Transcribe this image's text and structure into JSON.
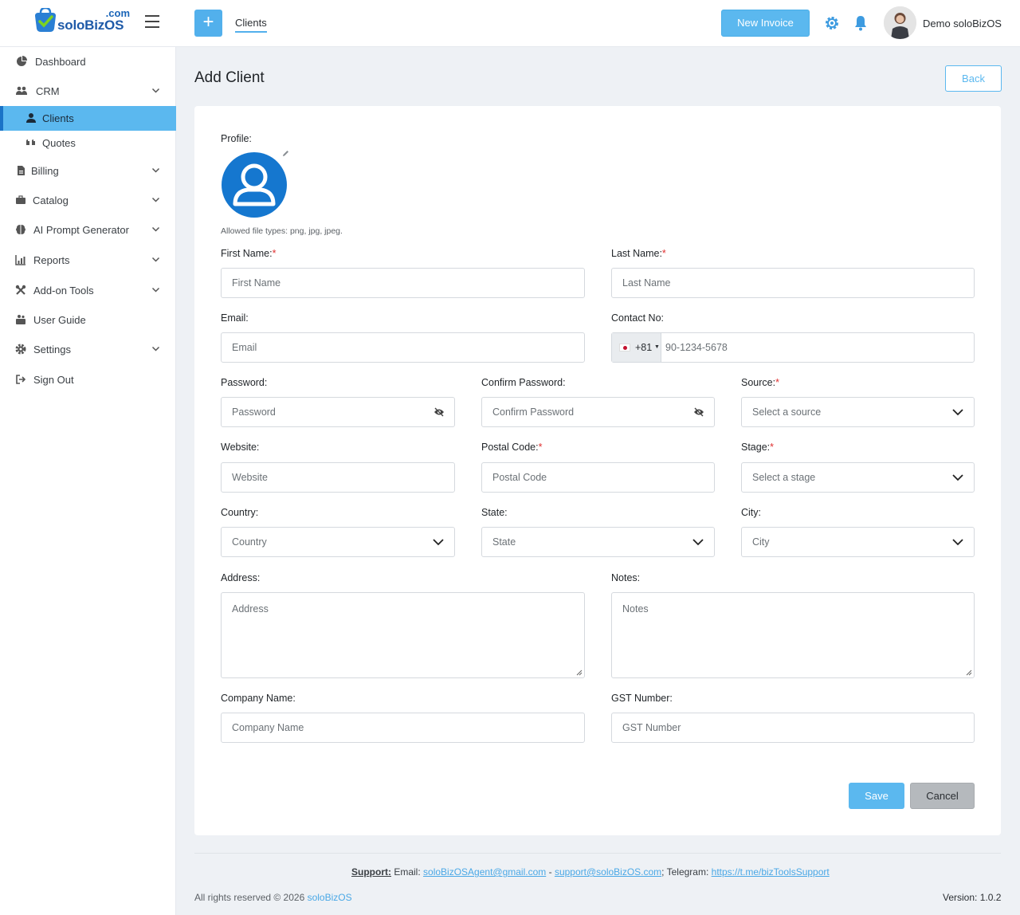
{
  "header": {
    "logo_suffix": ".com",
    "logo_text": "soloBizOS",
    "tab_label": "Clients",
    "new_invoice_label": "New Invoice",
    "user_name": "Demo soloBizOS"
  },
  "sidebar": {
    "items": [
      {
        "label": "Dashboard",
        "icon": "dashboard-icon"
      },
      {
        "label": "CRM",
        "icon": "users-icon",
        "expandable": true
      },
      {
        "label": "Clients",
        "icon": "user-icon",
        "active": true
      },
      {
        "label": "Quotes",
        "icon": "quote-icon"
      },
      {
        "label": "Billing",
        "icon": "file-icon",
        "expandable": true
      },
      {
        "label": "Catalog",
        "icon": "briefcase-icon",
        "expandable": true
      },
      {
        "label": "AI Prompt Generator",
        "icon": "brain-icon",
        "expandable": true
      },
      {
        "label": "Reports",
        "icon": "chart-icon",
        "expandable": true
      },
      {
        "label": "Add-on Tools",
        "icon": "tools-icon",
        "expandable": true
      },
      {
        "label": "User Guide",
        "icon": "guide-icon"
      },
      {
        "label": "Settings",
        "icon": "gear-icon",
        "expandable": true
      },
      {
        "label": "Sign Out",
        "icon": "sign-out-icon"
      }
    ]
  },
  "page": {
    "title": "Add Client",
    "back_label": "Back"
  },
  "form": {
    "profile_label": "Profile:",
    "allowed_types": "Allowed file types: png, jpg, jpeg.",
    "first_name": {
      "label": "First Name:",
      "placeholder": "First Name"
    },
    "last_name": {
      "label": "Last Name:",
      "placeholder": "Last Name"
    },
    "email": {
      "label": "Email:",
      "placeholder": "Email"
    },
    "contact": {
      "label": "Contact No:",
      "country_code": "+81",
      "placeholder": "90-1234-5678"
    },
    "password": {
      "label": "Password:",
      "placeholder": "Password"
    },
    "confirm_password": {
      "label": "Confirm Password:",
      "placeholder": "Confirm Password"
    },
    "source": {
      "label": "Source:",
      "placeholder": "Select a source"
    },
    "website": {
      "label": "Website:",
      "placeholder": "Website"
    },
    "postal_code": {
      "label": "Postal Code:",
      "placeholder": "Postal Code"
    },
    "stage": {
      "label": "Stage:",
      "placeholder": "Select a stage"
    },
    "country": {
      "label": "Country:",
      "placeholder": "Country"
    },
    "state": {
      "label": "State:",
      "placeholder": "State"
    },
    "city": {
      "label": "City:",
      "placeholder": "City"
    },
    "address": {
      "label": "Address:",
      "placeholder": "Address"
    },
    "notes": {
      "label": "Notes:",
      "placeholder": "Notes"
    },
    "company_name": {
      "label": "Company Name:",
      "placeholder": "Company Name"
    },
    "gst_number": {
      "label": "GST Number:",
      "placeholder": "GST Number"
    },
    "required_mark": "*",
    "save_label": "Save",
    "cancel_label": "Cancel"
  },
  "footer": {
    "support_label": "Support:",
    "email_prefix": " Email: ",
    "email_1": "soloBizOSAgent@gmail.com",
    "separator": " - ",
    "email_2": "support@soloBizOS.com",
    "telegram_prefix": "; Telegram: ",
    "telegram_link": "https://t.me/bizToolsSupport",
    "rights_text": "All rights reserved © 2026 ",
    "rights_brand": "soloBizOS",
    "version": "Version: 1.0.2"
  },
  "colors": {
    "accent": "#5bb8ef",
    "active_border": "#1a73c7",
    "required": "#e03131",
    "page_bg": "#eef1f5"
  }
}
